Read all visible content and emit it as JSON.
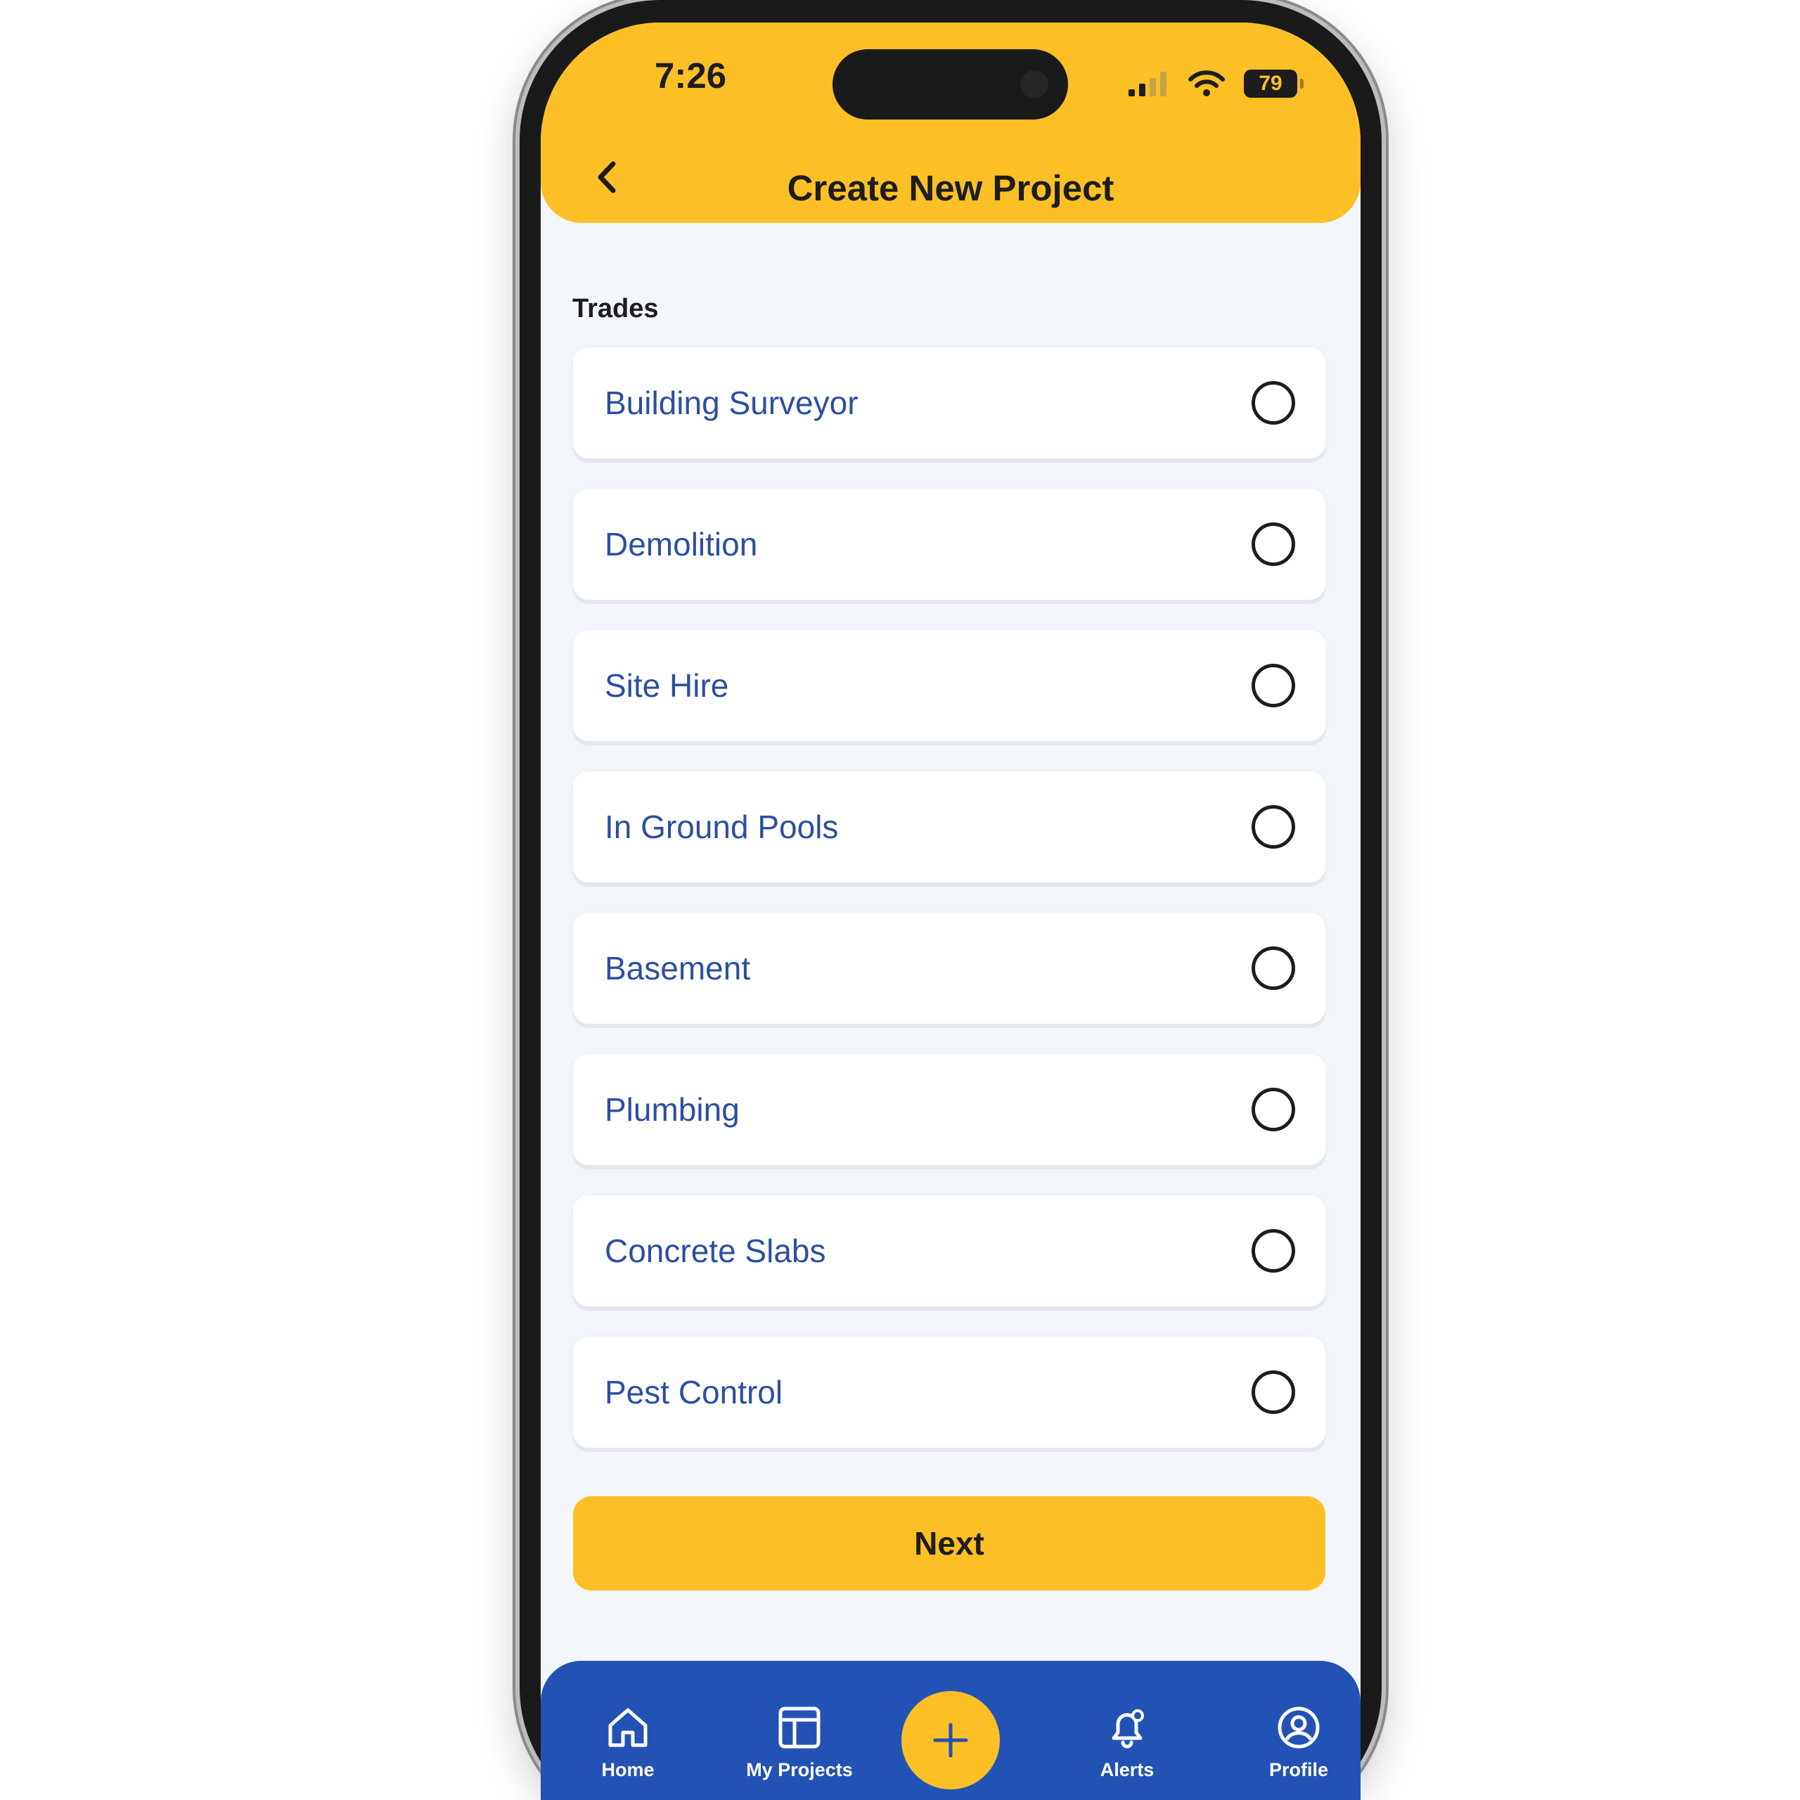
{
  "status_bar": {
    "time": "7:26",
    "battery": "79"
  },
  "header": {
    "title": "Create New Project"
  },
  "trades": {
    "label": "Trades",
    "items": [
      {
        "label": "Building Surveyor",
        "selected": false
      },
      {
        "label": "Demolition",
        "selected": false
      },
      {
        "label": "Site Hire",
        "selected": false
      },
      {
        "label": "In Ground Pools",
        "selected": false
      },
      {
        "label": "Basement",
        "selected": false
      },
      {
        "label": "Plumbing",
        "selected": false
      },
      {
        "label": "Concrete Slabs",
        "selected": false
      },
      {
        "label": "Pest Control",
        "selected": false
      }
    ]
  },
  "actions": {
    "next_label": "Next"
  },
  "bottom_nav": {
    "items": [
      {
        "label": "Home",
        "icon": "home-icon"
      },
      {
        "label": "My Projects",
        "icon": "projects-icon"
      },
      {
        "label": "",
        "icon": "plus-icon"
      },
      {
        "label": "Alerts",
        "icon": "bell-icon"
      },
      {
        "label": "Profile",
        "icon": "profile-icon"
      }
    ]
  },
  "colors": {
    "accent_yellow": "#fcbf26",
    "nav_blue": "#2352b5",
    "label_blue": "#2c4fa0",
    "background": "#f3f6fa"
  }
}
